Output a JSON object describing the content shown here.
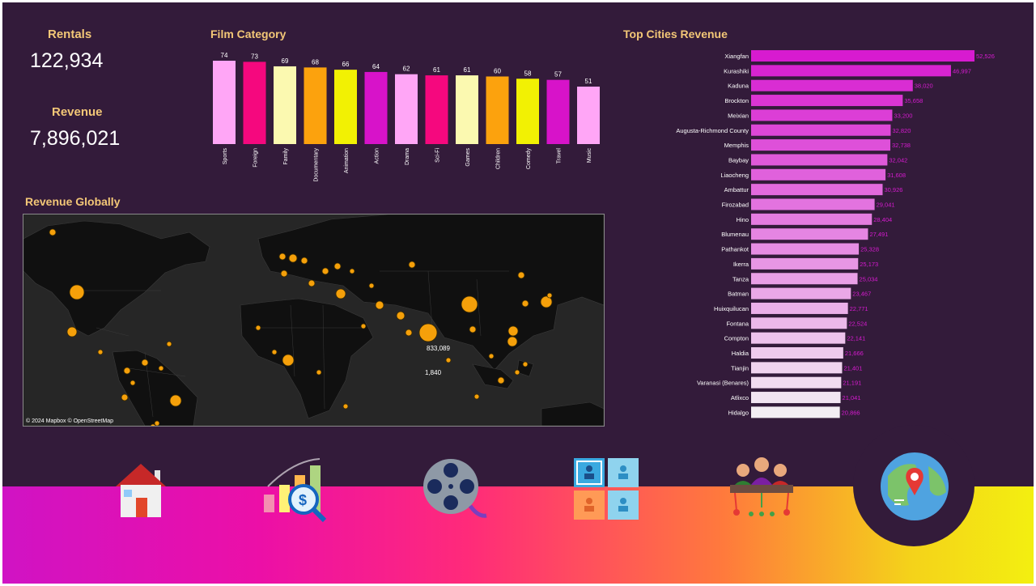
{
  "kpis": {
    "rentals_label": "Rentals",
    "rentals_value": "122,934",
    "revenue_label": "Revenue",
    "revenue_value": "7,896,021"
  },
  "panels": {
    "film_category_title": "Film Category",
    "revenue_globally_title": "Revenue Globally",
    "top_cities_title": "Top Cities Revenue"
  },
  "map": {
    "credit": "© 2024 Mapbox  © OpenStreetMap",
    "labels": [
      "833,089",
      "1,840"
    ]
  },
  "colors": {
    "background": "#331b3a",
    "accent_title": "#f3c777",
    "map_dot": "#f5a00a"
  },
  "nav": [
    "home-icon",
    "finance-analytics-icon",
    "film-reel-icon",
    "customers-icon",
    "staff-meeting-icon",
    "location-globe-icon"
  ],
  "chart_data": [
    {
      "type": "bar",
      "title": "Film Category",
      "categories": [
        "Sports",
        "Foreign",
        "Family",
        "Documentary",
        "Animation",
        "Action",
        "Drama",
        "Sci-Fi",
        "Games",
        "Children",
        "Comedy",
        "Travel",
        "Music"
      ],
      "values": [
        74,
        73,
        69,
        68,
        66,
        64,
        62,
        61,
        61,
        60,
        58,
        57,
        51
      ],
      "colors": [
        "#ffa6f6",
        "#f5087e",
        "#fbf9b0",
        "#fca20d",
        "#f2f103",
        "#d713c9",
        "#ffa6f6",
        "#f5087e",
        "#fbf9b0",
        "#fca20d",
        "#f2f103",
        "#d713c9",
        "#ffa6f6"
      ],
      "data_labels": [
        "74",
        "73",
        "69",
        "68",
        "66",
        "64",
        "62",
        "61",
        "61",
        "60",
        "58",
        "57",
        "51"
      ],
      "grid": false
    },
    {
      "type": "bar",
      "orientation": "horizontal",
      "title": "Top Cities Revenue",
      "categories": [
        "Xiangfan",
        "Kurashiki",
        "Kaduna",
        "Brockton",
        "Meixian",
        "Augusta-Richmond County",
        "Memphis",
        "Baybay",
        "Liaocheng",
        "Ambattur",
        "Firozabad",
        "Hino",
        "Blumenau",
        "Pathankot",
        "Ikerra",
        "Tanza",
        "Batman",
        "Huixquilucan",
        "Fontana",
        "Compton",
        "Haldia",
        "Tianjin",
        "Varanasi (Benares)",
        "Atlixco",
        "Hidalgo"
      ],
      "values": [
        52526,
        46997,
        38020,
        35658,
        33200,
        32820,
        32738,
        32042,
        31608,
        30926,
        29041,
        28404,
        27491,
        25328,
        25173,
        25034,
        23467,
        22771,
        22524,
        22141,
        21666,
        21401,
        21191,
        21041,
        20866
      ],
      "data_labels": [
        "52,526",
        "46,997",
        "38,020",
        "35,658",
        "33,200",
        "32,820",
        "32,738",
        "32,042",
        "31,608",
        "30,926",
        "29,041",
        "28,404",
        "27,491",
        "25,328",
        "25,173",
        "25,034",
        "23,467",
        "22,771",
        "22,524",
        "22,141",
        "21,666",
        "21,401",
        "21,191",
        "21,041",
        "20,866"
      ],
      "color_gradient": [
        "#d71bd0",
        "#f3eef3"
      ],
      "grid": false
    }
  ]
}
